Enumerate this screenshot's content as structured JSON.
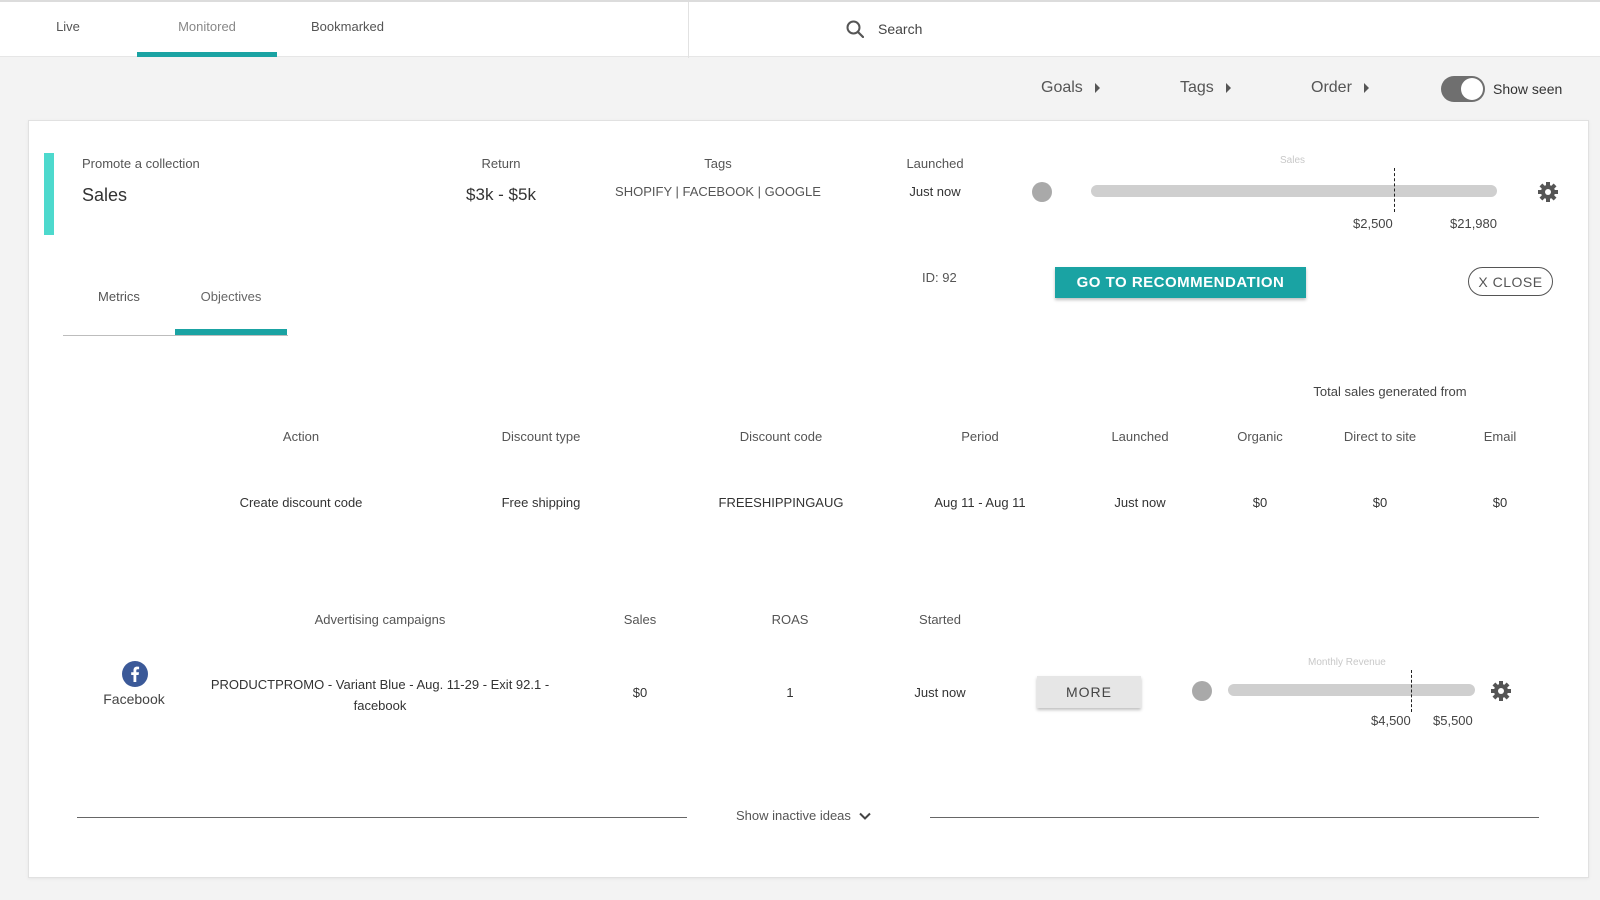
{
  "tabs": [
    "Live",
    "Monitored",
    "Bookmarked"
  ],
  "search": {
    "placeholder": "Search"
  },
  "filters": {
    "goals": "Goals",
    "tags": "Tags",
    "order": "Order",
    "show_seen": "Show seen"
  },
  "idea": {
    "type_label": "Promote a collection",
    "goal": "Sales",
    "return_label": "Return",
    "return_value": "$3k - $5k",
    "tags_label": "Tags",
    "tags_value": "SHOPIFY | FACEBOOK | GOOGLE",
    "launched_label": "Launched",
    "launched_value": "Just now",
    "slider_label": "Sales",
    "slider_marker_value": "$2,500",
    "slider_max_value": "$21,980",
    "id_text": "ID: 92",
    "go_button": "GO TO RECOMMENDATION",
    "close_button": "X CLOSE"
  },
  "subtabs": [
    "Metrics",
    "Objectives"
  ],
  "objectives": {
    "group_header": "Total sales generated from",
    "columns": [
      "Action",
      "Discount type",
      "Discount code",
      "Period",
      "Launched",
      "Organic",
      "Direct to site",
      "Email"
    ],
    "row": [
      "Create discount code",
      "Free shipping",
      "FREESHIPPINGAUG",
      "Aug 11 - Aug 11",
      "Just now",
      "$0",
      "$0",
      "$0"
    ]
  },
  "campaigns": {
    "columns": [
      "Advertising campaigns",
      "Sales",
      "ROAS",
      "Started"
    ],
    "platform": "Facebook",
    "name_line1": "PRODUCTPROMO - Variant Blue - Aug. 11-29 - Exit 92.1 -",
    "name_line2": "facebook",
    "sales": "$0",
    "roas": "1",
    "started": "Just now",
    "more_button": "MORE",
    "slider_label": "Monthly Revenue",
    "slider_marker_value": "$4,500",
    "slider_max_value": "$5,500"
  },
  "footer": {
    "show_inactive": "Show inactive ideas"
  },
  "colors": {
    "accent_teal": "#1aa3a3",
    "accent_bar": "#4dd9cd",
    "facebook_blue": "#3b5998"
  }
}
